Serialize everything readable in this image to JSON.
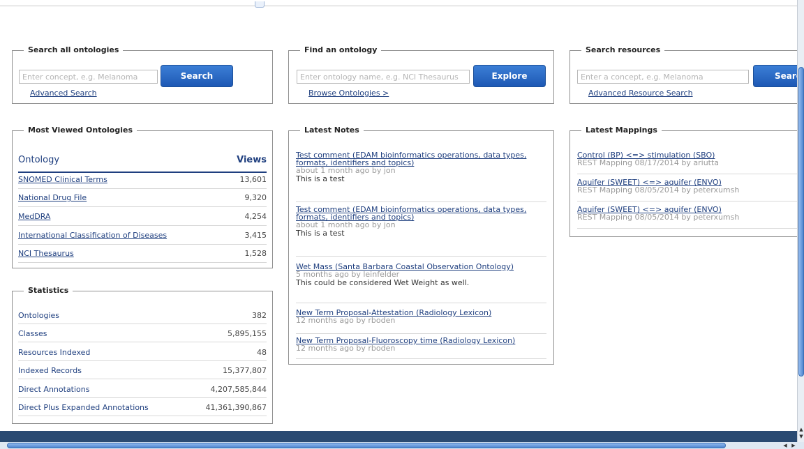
{
  "search_all": {
    "legend": "Search all ontologies",
    "placeholder": "Enter concept, e.g. Melanoma",
    "button": "Search",
    "link": "Advanced Search"
  },
  "find_ontology": {
    "legend": "Find an ontology",
    "placeholder": "Enter ontology name, e.g. NCI Thesaurus",
    "button": "Explore",
    "link": "Browse Ontologies >"
  },
  "search_resources": {
    "legend": "Search resources",
    "placeholder": "Enter a concept, e.g. Melanoma",
    "button": "Search",
    "link": "Advanced Resource Search"
  },
  "most_viewed": {
    "legend": "Most Viewed Ontologies",
    "col_ontology": "Ontology",
    "col_views": "Views",
    "rows": [
      {
        "name": "SNOMED Clinical Terms",
        "views": "13,601"
      },
      {
        "name": "National Drug File",
        "views": "9,320"
      },
      {
        "name": "MedDRA",
        "views": "4,254"
      },
      {
        "name": "International Classification of Diseases",
        "views": "3,415"
      },
      {
        "name": "NCI Thesaurus",
        "views": "1,528"
      }
    ]
  },
  "statistics": {
    "legend": "Statistics",
    "rows": [
      {
        "name": "Ontologies",
        "value": "382"
      },
      {
        "name": "Classes",
        "value": "5,895,155"
      },
      {
        "name": "Resources Indexed",
        "value": "48"
      },
      {
        "name": "Indexed Records",
        "value": "15,377,807"
      },
      {
        "name": "Direct Annotations",
        "value": "4,207,585,844"
      },
      {
        "name": "Direct Plus Expanded Annotations",
        "value": "41,361,390,867"
      }
    ]
  },
  "latest_notes": {
    "legend": "Latest Notes",
    "items": [
      {
        "title": "Test comment (EDAM bioinformatics operations, data types, formats, identifiers and topics)",
        "meta": "about 1 month ago by jon",
        "body": "This is a test"
      },
      {
        "title": "Test comment (EDAM bioinformatics operations, data types, formats, identifiers and topics)",
        "meta": "about 1 month ago by jon",
        "body": "This is a test"
      },
      {
        "title": "Wet Mass (Santa Barbara Coastal Observation Ontology)",
        "meta": "5 months ago by leinfelder",
        "body": "This could be considered Wet Weight as well."
      },
      {
        "title": "New Term Proposal-Attestation (Radiology Lexicon)",
        "meta": "12 months ago by rboden",
        "body": ""
      },
      {
        "title": "New Term Proposal-Fluoroscopy time (Radiology Lexicon)",
        "meta": "12 months ago by rboden",
        "body": ""
      }
    ]
  },
  "latest_mappings": {
    "legend": "Latest Mappings",
    "items": [
      {
        "title": "Control (BP) <=> stimulation (SBO)",
        "meta": "REST Mapping 08/17/2014 by ariutta"
      },
      {
        "title": "Aquifer (SWEET) <=> aquifer (ENVO)",
        "meta": "REST Mapping 08/05/2014 by peterxumsh"
      },
      {
        "title": "Aquifer (SWEET) <=> aquifer (ENVO)",
        "meta": "REST Mapping 08/05/2014 by peterxumsh"
      }
    ]
  }
}
